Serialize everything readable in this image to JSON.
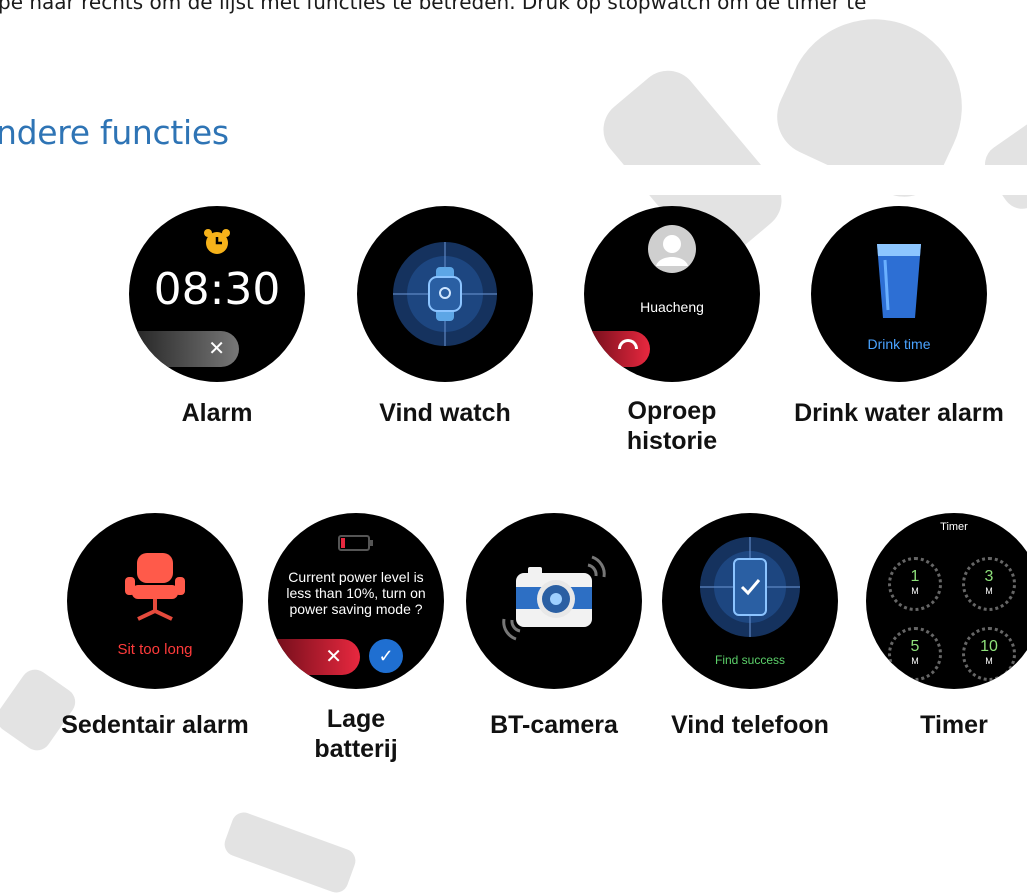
{
  "intro_text": "pe naar rechts om de lijst met functies te betreden. Druk op stopwatch om de timer te",
  "heading": "ndere functies",
  "watches": {
    "alarm": {
      "caption": "Alarm",
      "time": "08:30",
      "dismiss": "✕"
    },
    "find_watch": {
      "caption": "Vind watch"
    },
    "call_history": {
      "caption_1": "Oproep",
      "caption_2": "historie",
      "contact": "Huacheng"
    },
    "drink": {
      "caption": "Drink water alarm",
      "label": "Drink time"
    },
    "sedentary": {
      "caption": "Sedentair alarm",
      "label": "Sit too long"
    },
    "battery": {
      "caption_1": "Lage",
      "caption_2": "batterij",
      "message": "Current power level is less than 10%, turn on power saving mode ?"
    },
    "camera": {
      "caption": "BT-camera"
    },
    "find_phone": {
      "caption": "Vind telefoon",
      "label": "Find success"
    },
    "timer": {
      "caption": "Timer",
      "title": "Timer",
      "presets": [
        {
          "value": "1",
          "unit": "M"
        },
        {
          "value": "3",
          "unit": "M"
        },
        {
          "value": "5",
          "unit": "M"
        },
        {
          "value": "10",
          "unit": "M"
        }
      ]
    }
  },
  "colors": {
    "heading": "#2e74b5",
    "decline": "#e8283f",
    "confirm": "#1f6fd1",
    "find_success": "#5cd16a",
    "timer_accent": "#8ee07a"
  }
}
